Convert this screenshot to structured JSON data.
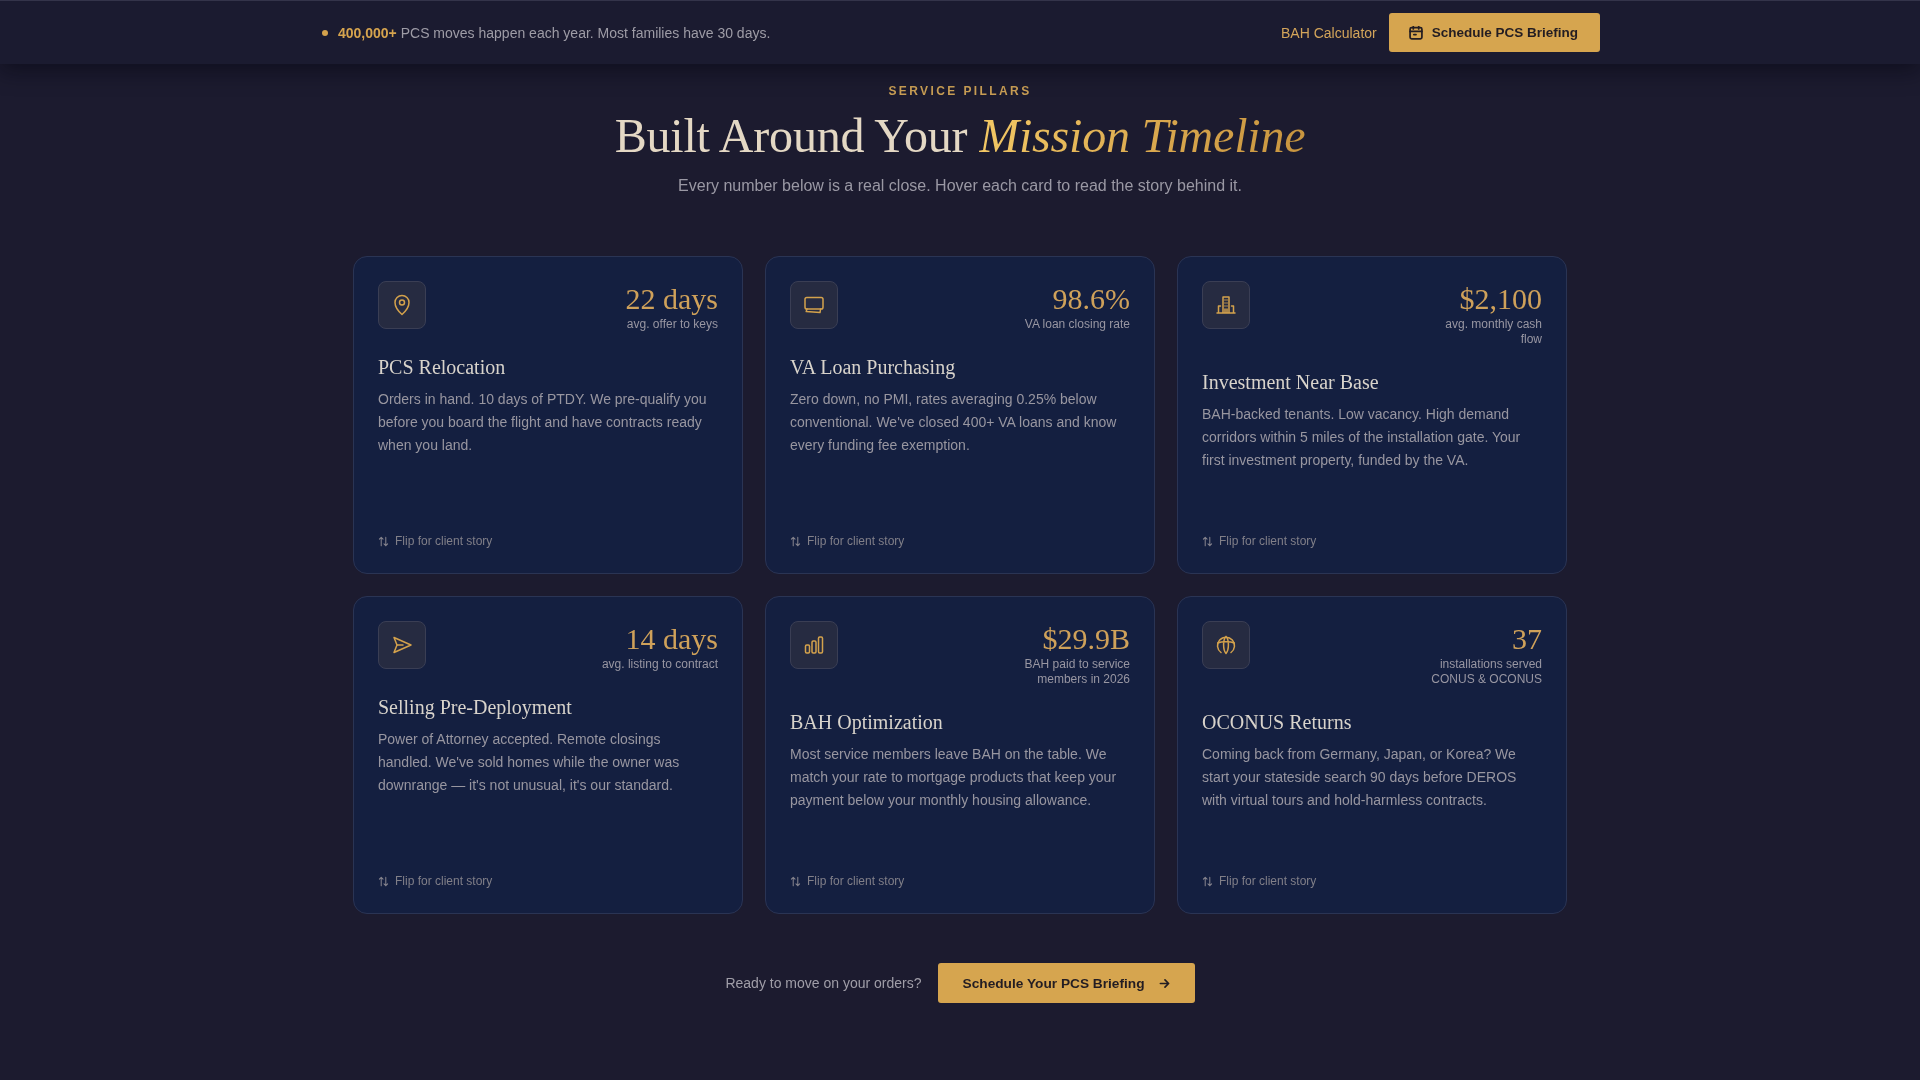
{
  "top_bar": {
    "announcement": "**400,000+** PCS moves happen each year. Most families have 30 days.",
    "link": "BAH Calculator",
    "button": "Schedule PCS Briefing"
  },
  "section": {
    "eyebrow": "SERVICE PILLARS",
    "title": "Built Around Your *Mission Timeline*",
    "subtitle": "Every number below is a real close. Hover each card to read the story behind it."
  },
  "cards": [
    {
      "stat": "22 days",
      "stat_label": "avg. offer to keys",
      "title": "PCS Relocation",
      "description": "Orders in hand. 10 days of PTDY. We pre-qualify you before you board the flight and have contracts ready when you land.",
      "flip_hint": "Flip for client story"
    },
    {
      "stat": "98.6%",
      "stat_label": "VA loan closing rate",
      "title": "VA Loan Purchasing",
      "description": "Zero down, no PMI, rates averaging 0.25% below conventional. We've closed 400+ VA loans and know every funding fee exemption.",
      "flip_hint": "Flip for client story"
    },
    {
      "stat": "$2,100",
      "stat_label": "avg. monthly cash flow",
      "title": "Investment Near Base",
      "description": "BAH-backed tenants. Low vacancy. High demand corridors within 5 miles of the installation gate. Your first investment property, funded by the VA.",
      "flip_hint": "Flip for client story"
    },
    {
      "stat": "14 days",
      "stat_label": "avg. listing to contract",
      "title": "Selling Pre-Deployment",
      "description": "Power of Attorney accepted. Remote closings handled. We've sold homes while the owner was downrange — it's not unusual, it's our standard.",
      "flip_hint": "Flip for client story"
    },
    {
      "stat": "$29.9B",
      "stat_label": "BAH paid to service members in 2026",
      "title": "BAH Optimization",
      "description": "Most service members leave BAH on the table. We match your rate to mortgage products that keep your payment below your monthly housing allowance.",
      "flip_hint": "Flip for client story"
    },
    {
      "stat": "37",
      "stat_label": "installations served CONUS & OCONUS",
      "title": "OCONUS Returns",
      "description": "Coming back from Germany, Japan, or Korea? We start your stateside search 90 days before DEROS with virtual tours and hold-harmless contracts.",
      "flip_hint": "Flip for client story"
    }
  ],
  "cta": {
    "prompt": "Ready to move on your orders?",
    "button": "Schedule Your PCS Briefing"
  }
}
